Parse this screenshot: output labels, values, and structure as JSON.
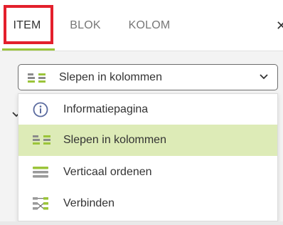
{
  "tabs": [
    {
      "label": "ITEM",
      "active": true
    },
    {
      "label": "BLOK",
      "active": false
    },
    {
      "label": "KOLOM",
      "active": false
    }
  ],
  "close_glyph": "✕",
  "select": {
    "value": "Slepen in kolommen",
    "icon": "drag-columns-icon"
  },
  "options": [
    {
      "label": "Informatiepagina",
      "icon": "info-icon",
      "selected": false
    },
    {
      "label": "Slepen in kolommen",
      "icon": "drag-columns-icon",
      "selected": true
    },
    {
      "label": "Verticaal ordenen",
      "icon": "vertical-order-icon",
      "selected": false
    },
    {
      "label": "Verbinden",
      "icon": "connect-icon",
      "selected": false
    }
  ],
  "colors": {
    "accent_green": "#9bc43a",
    "selected_bg": "#ddebb7",
    "highlight_red": "#e3202c",
    "info_blue": "#5a6a9e"
  }
}
